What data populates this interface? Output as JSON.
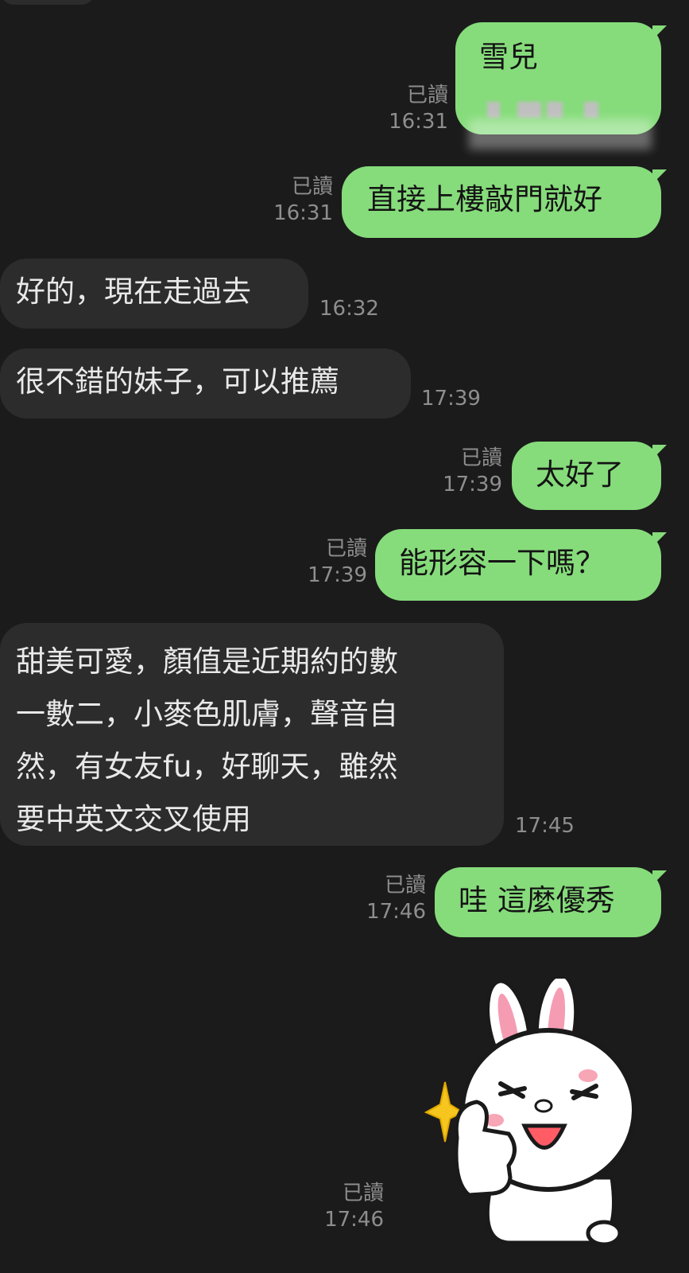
{
  "messages": [
    {
      "side": "out",
      "text": "雪兒",
      "read": "已讀",
      "time": "16:31"
    },
    {
      "side": "out",
      "text": "直接上樓敲門就好",
      "read": "已讀",
      "time": "16:31"
    },
    {
      "side": "in",
      "text": "好的，現在走過去",
      "time": "16:32"
    },
    {
      "side": "in",
      "text": "很不錯的妹子，可以推薦",
      "time": "17:39"
    },
    {
      "side": "out",
      "text": "太好了",
      "read": "已讀",
      "time": "17:39"
    },
    {
      "side": "out",
      "text": "能形容一下嗎？",
      "read": "已讀",
      "time": "17:39"
    },
    {
      "side": "in",
      "lines": [
        "甜美可愛，顏值是近期約的數",
        "一數二，小麥色肌膚，聲音自",
        "然，有女友fu，好聊天，雖然",
        "要中英文交叉使用"
      ],
      "time": "17:45"
    },
    {
      "side": "out",
      "text": "哇 這麼優秀",
      "read": "已讀",
      "time": "17:46"
    },
    {
      "side": "out",
      "type": "sticker",
      "sticker": "bunny-thumbs-up-sticker",
      "read": "已讀",
      "time": "17:46"
    }
  ],
  "colors": {
    "background": "#1b1b1b",
    "outgoing_bubble": "#86dc7b",
    "incoming_bubble": "#2c2c2c",
    "meta_text": "#8e8e8e"
  }
}
